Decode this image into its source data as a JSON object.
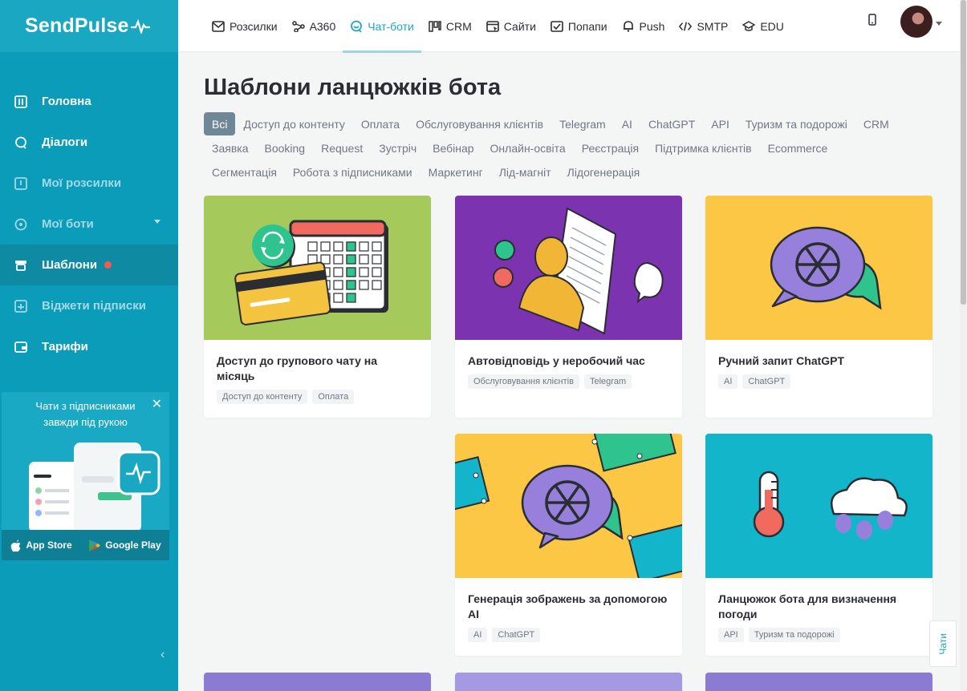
{
  "app": {
    "logo": "SendPulse"
  },
  "topnav": {
    "tabs": [
      {
        "label": "Розсилки",
        "icon": "envelope-icon"
      },
      {
        "label": "A360",
        "icon": "network-icon"
      },
      {
        "label": "Чат-боти",
        "icon": "chatbot-icon",
        "active": true
      },
      {
        "label": "CRM",
        "icon": "crm-icon"
      },
      {
        "label": "Сайти",
        "icon": "website-icon"
      },
      {
        "label": "Попапи",
        "icon": "popup-icon"
      },
      {
        "label": "Push",
        "icon": "bell-icon"
      },
      {
        "label": "SMTP",
        "icon": "code-icon"
      },
      {
        "label": "EDU",
        "icon": "graduation-cap-icon"
      }
    ]
  },
  "sidebar": {
    "items": [
      {
        "label": "Головна",
        "icon": "dashboard-icon"
      },
      {
        "label": "Діалоги",
        "icon": "chat-bubble-icon"
      },
      {
        "label": "Мої розсилки",
        "icon": "mailings-icon"
      },
      {
        "label": "Мої боти",
        "icon": "bot-icon"
      },
      {
        "label": "Шаблони",
        "icon": "templates-icon"
      },
      {
        "label": "Віджети підписки",
        "icon": "widget-icon"
      },
      {
        "label": "Тарифи",
        "icon": "wallet-icon"
      }
    ],
    "promo": {
      "text_line1": "Чати з підписниками",
      "text_line2": "завжди під рукою",
      "close": "✕",
      "app_store": "App Store",
      "google_play": "Google Play"
    },
    "collapse": "‹"
  },
  "page": {
    "title": "Шаблони ланцюжків бота",
    "filters": [
      "Всі",
      "Доступ до контенту",
      "Оплата",
      "Обслуговування клієнтів",
      "Telegram",
      "AI",
      "ChatGPT",
      "API",
      "Туризм та подорожі",
      "CRM",
      "Заявка",
      "Booking",
      "Request",
      "Зустріч",
      "Вебінар",
      "Онлайн-освіта",
      "Реєстрація",
      "Підтримка клієнтів",
      "Ecommerce",
      "Сегментація",
      "Робота з підписниками",
      "Маркетинг",
      "Лід-магніт",
      "Лідогенерація"
    ],
    "cards": [
      {
        "title": "Доступ до групового чату на місяць",
        "tags": [
          "Доступ до контенту",
          "Оплата"
        ],
        "bg": "#a5c95b"
      },
      {
        "title": "Автовідповідь у неробочий час",
        "tags": [
          "Обслуговування клієнтів",
          "Telegram"
        ],
        "bg": "#7c33b0"
      },
      {
        "title": "Ручний запит ChatGPT",
        "tags": [
          "AI",
          "ChatGPT"
        ],
        "bg": "#fcc744"
      },
      {
        "title": "Генерація зображень за допомогою AI",
        "tags": [
          "AI",
          "ChatGPT"
        ],
        "bg": "#fcc744"
      },
      {
        "title": "Ланцюжок бота для визначення погоди",
        "tags": [
          "API",
          "Туризм та подорожі"
        ],
        "bg": "#12b5c9"
      }
    ],
    "chat_side": "Чати"
  },
  "colors": {
    "brand": "#0a9cb8",
    "accent": "#1aa7c2",
    "badge": "#f25c4a"
  }
}
